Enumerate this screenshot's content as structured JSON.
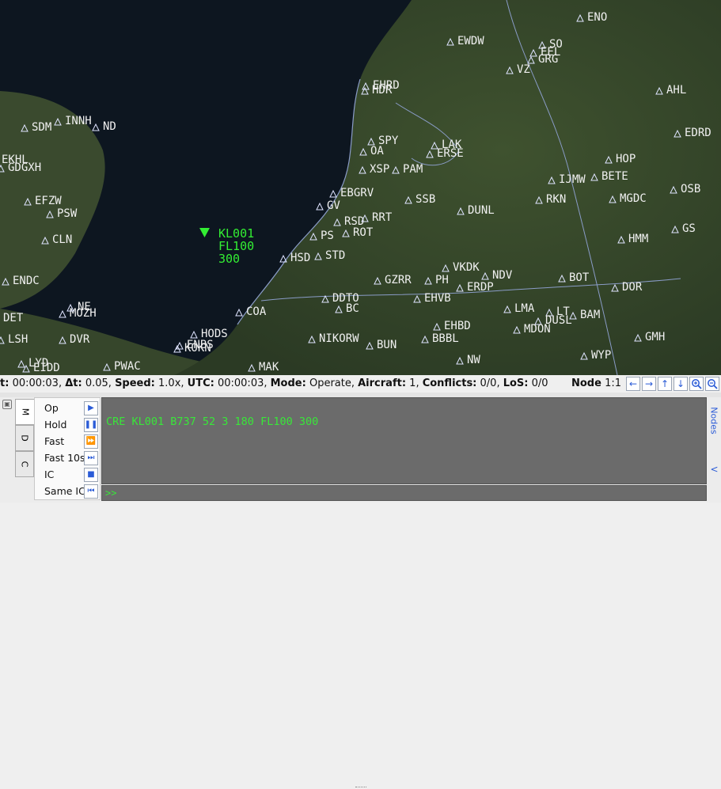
{
  "map": {
    "aircraft": {
      "callsign": "KL001",
      "flight_level": "FL100",
      "speed": "300",
      "color": "#33ee33"
    },
    "waypoints": [
      "ENO",
      "EWDW",
      "SO",
      "EEL",
      "GRG",
      "VZ",
      "EHRD",
      "HDR",
      "AHL",
      "EDRD",
      "SPY",
      "LAK",
      "ERSE",
      "OA",
      "XSP",
      "PAM",
      "HOP",
      "BETE",
      "IJMW",
      "EBGRV",
      "SSB",
      "RKN",
      "OSB",
      "MGDC",
      "GV",
      "RSD",
      "RRT",
      "ROT",
      "DUNL",
      "PS",
      "HMM",
      "GS",
      "HSD",
      "STD",
      "BOT",
      "DOR",
      "GZRR",
      "PH",
      "VKDK",
      "NDV",
      "ERDP",
      "EHVB",
      "DDTO",
      "BC",
      "LMA",
      "LT",
      "BAM",
      "COA",
      "HODS",
      "ENBS",
      "NIKORW",
      "BUN",
      "EHBD",
      "BBBL",
      "DUSL",
      "MDON",
      "GMH",
      "KOKN",
      "WYP",
      "NW",
      "MAK",
      "PWAC",
      "LYD",
      "EIDD",
      "LSH",
      "DVR",
      "MOZH",
      "NE",
      "DET",
      "ENDC",
      "CLN",
      "PSW",
      "EFZW",
      "GDGXH",
      "EKHL",
      "SDM",
      "INNH",
      "ND"
    ],
    "colors": {
      "sea": "#0d1620",
      "land": "#34432a",
      "label": "#f0f0f0",
      "symbol": "#dfe4ff"
    }
  },
  "status": {
    "t_label": "t:",
    "t_value": "00:00:03",
    "dt_label": "Δt:",
    "dt_value": "0.05",
    "speed_label": "Speed:",
    "speed_value": "1.0x",
    "utc_label": "UTC:",
    "utc_value": "00:00:03",
    "mode_label": "Mode:",
    "mode_value": "Operate",
    "aircraft_label": "Aircraft:",
    "aircraft_value": "1",
    "conflicts_label": "Conflicts:",
    "conflicts_value": "0/0",
    "los_label": "LoS:",
    "los_value": "0/0",
    "node_label": "Node",
    "node_value": "1:1"
  },
  "tabs": [
    "M",
    "D",
    "C"
  ],
  "sim_controls": [
    {
      "label": "Op",
      "icon": "play-icon"
    },
    {
      "label": "Hold",
      "icon": "pause-icon"
    },
    {
      "label": "Fast",
      "icon": "fast-forward-icon"
    },
    {
      "label": "Fast 10s",
      "icon": "skip-forward-icon"
    },
    {
      "label": "IC",
      "icon": "stop-icon"
    },
    {
      "label": "Same IC",
      "icon": "skip-back-icon"
    }
  ],
  "console": {
    "output": "CRE KL001 B737 52 3 180 FL100 300",
    "prompt": ">>",
    "input_value": "",
    "text_color": "#39e639"
  },
  "nodes_panel": {
    "label": "Nodes",
    "collapse_glyph": "<"
  }
}
